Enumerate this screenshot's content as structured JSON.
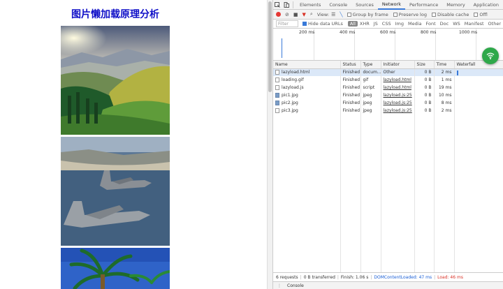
{
  "page": {
    "title": "图片懒加载原理分析"
  },
  "devtools": {
    "tabs": [
      "Elements",
      "Console",
      "Sources",
      "Network",
      "Performance",
      "Memory",
      "Application"
    ],
    "active_tab": "Network",
    "toolbar": {
      "view_label": "View:",
      "group_by_frame": "Group by frame",
      "preserve_log": "Preserve log",
      "disable_cache": "Disable cache",
      "offline": "Offl"
    },
    "filter": {
      "placeholder": "Filter",
      "hide_data_urls": "Hide data URLs",
      "types": [
        "All",
        "XHR",
        "JS",
        "CSS",
        "Img",
        "Media",
        "Font",
        "Doc",
        "WS",
        "Manifest",
        "Other"
      ]
    },
    "overview_ticks": [
      "200 ms",
      "400 ms",
      "600 ms",
      "800 ms",
      "1000 ms"
    ],
    "columns": [
      "Name",
      "Status",
      "Type",
      "Initiator",
      "Size",
      "Time",
      "Waterfall"
    ],
    "rows": [
      {
        "name": "lazyload.html",
        "status": "Finished",
        "type": "docum...",
        "initiator": "Other",
        "size": "0 B",
        "time": "2 ms",
        "icon": "doc"
      },
      {
        "name": "loading.gif",
        "status": "Finished",
        "type": "gif",
        "initiator": "lazyload.html",
        "size": "0 B",
        "time": "1 ms",
        "icon": "doc"
      },
      {
        "name": "lazyload.js",
        "status": "Finished",
        "type": "script",
        "initiator": "lazyload.html",
        "size": "0 B",
        "time": "19 ms",
        "icon": "doc"
      },
      {
        "name": "pic1.jpg",
        "status": "Finished",
        "type": "jpeg",
        "initiator": "lazyload.js:25",
        "size": "0 B",
        "time": "10 ms",
        "icon": "img"
      },
      {
        "name": "pic2.jpg",
        "status": "Finished",
        "type": "jpeg",
        "initiator": "lazyload.js:25",
        "size": "0 B",
        "time": "8 ms",
        "icon": "img"
      },
      {
        "name": "pic3.jpg",
        "status": "Finished",
        "type": "jpeg",
        "initiator": "lazyload.js:25",
        "size": "0 B",
        "time": "2 ms",
        "icon": "doc"
      }
    ],
    "status": {
      "requests": "6 requests",
      "transferred": "0 B transferred",
      "finish": "Finish: 1.06 s",
      "dom_content_loaded": "DOMContentLoaded: 47 ms",
      "load": "Load: 46 ms"
    },
    "drawer_tab": "Console"
  },
  "colors": {
    "title": "#1010c8",
    "accent": "#3879d9",
    "record": "#e53935",
    "fab": "#2ea84a"
  }
}
